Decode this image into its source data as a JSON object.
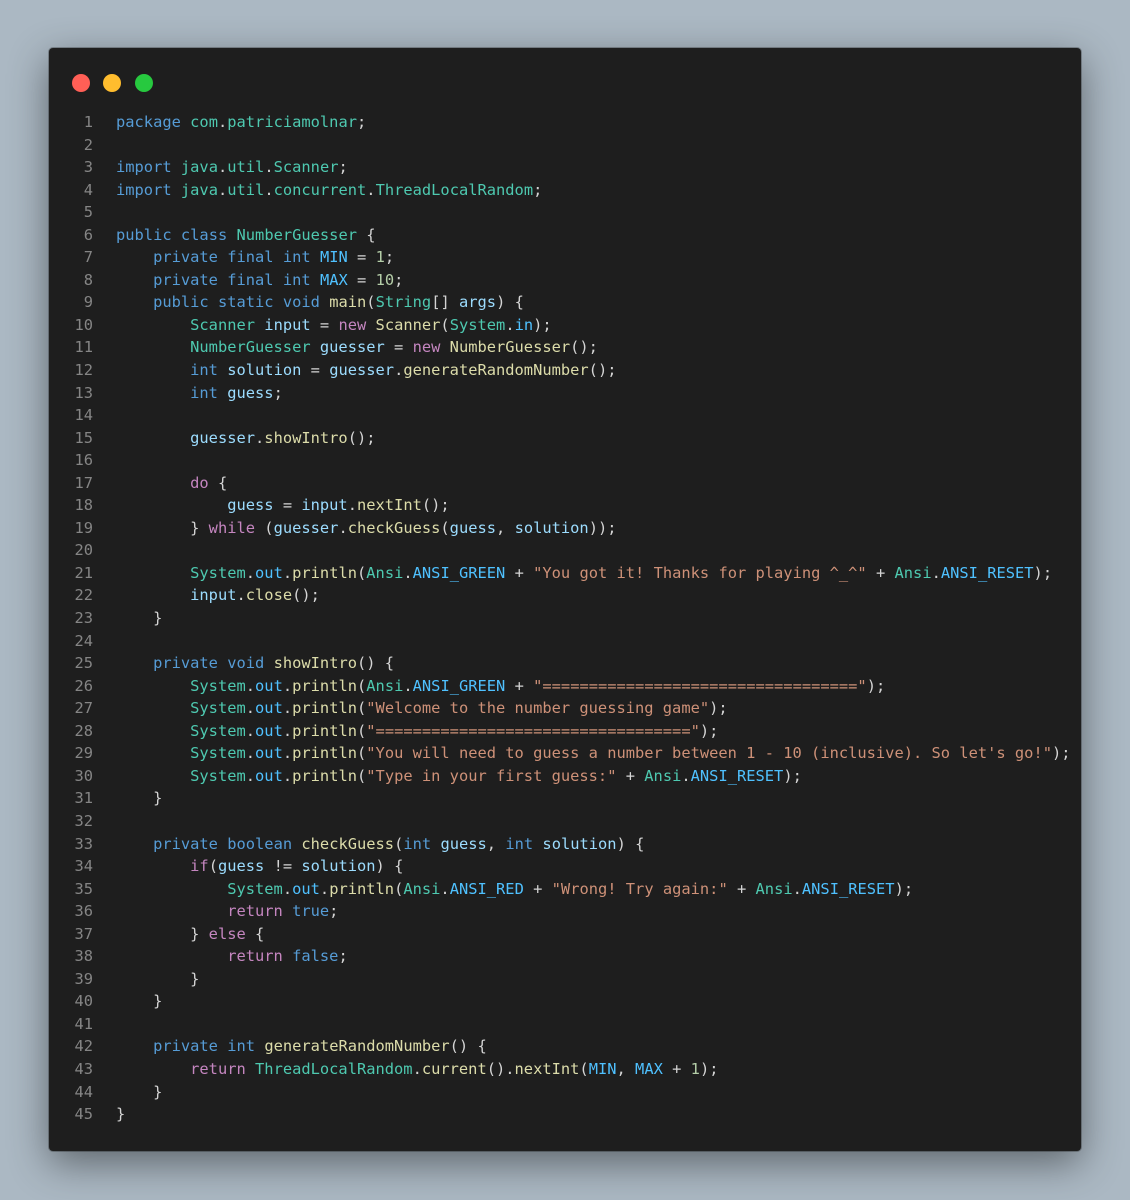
{
  "window": {
    "buttons": [
      "close",
      "minimize",
      "maximize"
    ],
    "colors": {
      "background": "#1e1e1e",
      "page_background": "#abb8c3",
      "close": "#ff5f56",
      "minimize": "#ffbd2e",
      "maximize": "#27c93f"
    }
  },
  "editor": {
    "language": "java",
    "lines": [
      [
        [
          "kw",
          "package"
        ],
        [
          "pl",
          " "
        ],
        [
          "ty",
          "com"
        ],
        [
          "pl",
          "."
        ],
        [
          "ty",
          "patriciamolnar"
        ],
        [
          "pl",
          ";"
        ]
      ],
      [],
      [
        [
          "kw",
          "import"
        ],
        [
          "pl",
          " "
        ],
        [
          "ty",
          "java"
        ],
        [
          "pl",
          "."
        ],
        [
          "ty",
          "util"
        ],
        [
          "pl",
          "."
        ],
        [
          "ty",
          "Scanner"
        ],
        [
          "pl",
          ";"
        ]
      ],
      [
        [
          "kw",
          "import"
        ],
        [
          "pl",
          " "
        ],
        [
          "ty",
          "java"
        ],
        [
          "pl",
          "."
        ],
        [
          "ty",
          "util"
        ],
        [
          "pl",
          "."
        ],
        [
          "ty",
          "concurrent"
        ],
        [
          "pl",
          "."
        ],
        [
          "ty",
          "ThreadLocalRandom"
        ],
        [
          "pl",
          ";"
        ]
      ],
      [],
      [
        [
          "kw",
          "public"
        ],
        [
          "pl",
          " "
        ],
        [
          "kw",
          "class"
        ],
        [
          "pl",
          " "
        ],
        [
          "ty",
          "NumberGuesser"
        ],
        [
          "pl",
          " {"
        ]
      ],
      [
        [
          "pl",
          "    "
        ],
        [
          "kw",
          "private"
        ],
        [
          "pl",
          " "
        ],
        [
          "kw",
          "final"
        ],
        [
          "pl",
          " "
        ],
        [
          "kw",
          "int"
        ],
        [
          "pl",
          " "
        ],
        [
          "cn",
          "MIN"
        ],
        [
          "pl",
          " = "
        ],
        [
          "nm",
          "1"
        ],
        [
          "pl",
          ";"
        ]
      ],
      [
        [
          "pl",
          "    "
        ],
        [
          "kw",
          "private"
        ],
        [
          "pl",
          " "
        ],
        [
          "kw",
          "final"
        ],
        [
          "pl",
          " "
        ],
        [
          "kw",
          "int"
        ],
        [
          "pl",
          " "
        ],
        [
          "cn",
          "MAX"
        ],
        [
          "pl",
          " = "
        ],
        [
          "nm",
          "10"
        ],
        [
          "pl",
          ";"
        ]
      ],
      [
        [
          "pl",
          "    "
        ],
        [
          "kw",
          "public"
        ],
        [
          "pl",
          " "
        ],
        [
          "kw",
          "static"
        ],
        [
          "pl",
          " "
        ],
        [
          "kw",
          "void"
        ],
        [
          "pl",
          " "
        ],
        [
          "fn",
          "main"
        ],
        [
          "pl",
          "("
        ],
        [
          "ty",
          "String"
        ],
        [
          "pl",
          "[] "
        ],
        [
          "vr",
          "args"
        ],
        [
          "pl",
          ") {"
        ]
      ],
      [
        [
          "pl",
          "        "
        ],
        [
          "ty",
          "Scanner"
        ],
        [
          "pl",
          " "
        ],
        [
          "vr",
          "input"
        ],
        [
          "pl",
          " = "
        ],
        [
          "ctl",
          "new"
        ],
        [
          "pl",
          " "
        ],
        [
          "fn",
          "Scanner"
        ],
        [
          "pl",
          "("
        ],
        [
          "ty",
          "System"
        ],
        [
          "pl",
          "."
        ],
        [
          "cn",
          "in"
        ],
        [
          "pl",
          ");"
        ]
      ],
      [
        [
          "pl",
          "        "
        ],
        [
          "ty",
          "NumberGuesser"
        ],
        [
          "pl",
          " "
        ],
        [
          "vr",
          "guesser"
        ],
        [
          "pl",
          " = "
        ],
        [
          "ctl",
          "new"
        ],
        [
          "pl",
          " "
        ],
        [
          "fn",
          "NumberGuesser"
        ],
        [
          "pl",
          "();"
        ]
      ],
      [
        [
          "pl",
          "        "
        ],
        [
          "kw",
          "int"
        ],
        [
          "pl",
          " "
        ],
        [
          "vr",
          "solution"
        ],
        [
          "pl",
          " = "
        ],
        [
          "vr",
          "guesser"
        ],
        [
          "pl",
          "."
        ],
        [
          "fn",
          "generateRandomNumber"
        ],
        [
          "pl",
          "();"
        ]
      ],
      [
        [
          "pl",
          "        "
        ],
        [
          "kw",
          "int"
        ],
        [
          "pl",
          " "
        ],
        [
          "vr",
          "guess"
        ],
        [
          "pl",
          ";"
        ]
      ],
      [],
      [
        [
          "pl",
          "        "
        ],
        [
          "vr",
          "guesser"
        ],
        [
          "pl",
          "."
        ],
        [
          "fn",
          "showIntro"
        ],
        [
          "pl",
          "();"
        ]
      ],
      [],
      [
        [
          "pl",
          "        "
        ],
        [
          "ctl",
          "do"
        ],
        [
          "pl",
          " {"
        ]
      ],
      [
        [
          "pl",
          "            "
        ],
        [
          "vr",
          "guess"
        ],
        [
          "pl",
          " = "
        ],
        [
          "vr",
          "input"
        ],
        [
          "pl",
          "."
        ],
        [
          "fn",
          "nextInt"
        ],
        [
          "pl",
          "();"
        ]
      ],
      [
        [
          "pl",
          "        } "
        ],
        [
          "ctl",
          "while"
        ],
        [
          "pl",
          " ("
        ],
        [
          "vr",
          "guesser"
        ],
        [
          "pl",
          "."
        ],
        [
          "fn",
          "checkGuess"
        ],
        [
          "pl",
          "("
        ],
        [
          "vr",
          "guess"
        ],
        [
          "pl",
          ", "
        ],
        [
          "vr",
          "solution"
        ],
        [
          "pl",
          "));"
        ]
      ],
      [],
      [
        [
          "pl",
          "        "
        ],
        [
          "ty",
          "System"
        ],
        [
          "pl",
          "."
        ],
        [
          "cn",
          "out"
        ],
        [
          "pl",
          "."
        ],
        [
          "fn",
          "println"
        ],
        [
          "pl",
          "("
        ],
        [
          "ty",
          "Ansi"
        ],
        [
          "pl",
          "."
        ],
        [
          "cn",
          "ANSI_GREEN"
        ],
        [
          "pl",
          " + "
        ],
        [
          "st",
          "\"You got it! Thanks for playing ^_^\""
        ],
        [
          "pl",
          " + "
        ],
        [
          "ty",
          "Ansi"
        ],
        [
          "pl",
          "."
        ],
        [
          "cn",
          "ANSI_RESET"
        ],
        [
          "pl",
          ");"
        ]
      ],
      [
        [
          "pl",
          "        "
        ],
        [
          "vr",
          "input"
        ],
        [
          "pl",
          "."
        ],
        [
          "fn",
          "close"
        ],
        [
          "pl",
          "();"
        ]
      ],
      [
        [
          "pl",
          "    }"
        ]
      ],
      [],
      [
        [
          "pl",
          "    "
        ],
        [
          "kw",
          "private"
        ],
        [
          "pl",
          " "
        ],
        [
          "kw",
          "void"
        ],
        [
          "pl",
          " "
        ],
        [
          "fn",
          "showIntro"
        ],
        [
          "pl",
          "() {"
        ]
      ],
      [
        [
          "pl",
          "        "
        ],
        [
          "ty",
          "System"
        ],
        [
          "pl",
          "."
        ],
        [
          "cn",
          "out"
        ],
        [
          "pl",
          "."
        ],
        [
          "fn",
          "println"
        ],
        [
          "pl",
          "("
        ],
        [
          "ty",
          "Ansi"
        ],
        [
          "pl",
          "."
        ],
        [
          "cn",
          "ANSI_GREEN"
        ],
        [
          "pl",
          " + "
        ],
        [
          "st",
          "\"==================================\""
        ],
        [
          "pl",
          ");"
        ]
      ],
      [
        [
          "pl",
          "        "
        ],
        [
          "ty",
          "System"
        ],
        [
          "pl",
          "."
        ],
        [
          "cn",
          "out"
        ],
        [
          "pl",
          "."
        ],
        [
          "fn",
          "println"
        ],
        [
          "pl",
          "("
        ],
        [
          "st",
          "\"Welcome to the number guessing game\""
        ],
        [
          "pl",
          ");"
        ]
      ],
      [
        [
          "pl",
          "        "
        ],
        [
          "ty",
          "System"
        ],
        [
          "pl",
          "."
        ],
        [
          "cn",
          "out"
        ],
        [
          "pl",
          "."
        ],
        [
          "fn",
          "println"
        ],
        [
          "pl",
          "("
        ],
        [
          "st",
          "\"==================================\""
        ],
        [
          "pl",
          ");"
        ]
      ],
      [
        [
          "pl",
          "        "
        ],
        [
          "ty",
          "System"
        ],
        [
          "pl",
          "."
        ],
        [
          "cn",
          "out"
        ],
        [
          "pl",
          "."
        ],
        [
          "fn",
          "println"
        ],
        [
          "pl",
          "("
        ],
        [
          "st",
          "\"You will need to guess a number between 1 - 10 (inclusive). So let's go!\""
        ],
        [
          "pl",
          ");"
        ]
      ],
      [
        [
          "pl",
          "        "
        ],
        [
          "ty",
          "System"
        ],
        [
          "pl",
          "."
        ],
        [
          "cn",
          "out"
        ],
        [
          "pl",
          "."
        ],
        [
          "fn",
          "println"
        ],
        [
          "pl",
          "("
        ],
        [
          "st",
          "\"Type in your first guess:\""
        ],
        [
          "pl",
          " + "
        ],
        [
          "ty",
          "Ansi"
        ],
        [
          "pl",
          "."
        ],
        [
          "cn",
          "ANSI_RESET"
        ],
        [
          "pl",
          ");"
        ]
      ],
      [
        [
          "pl",
          "    }"
        ]
      ],
      [],
      [
        [
          "pl",
          "    "
        ],
        [
          "kw",
          "private"
        ],
        [
          "pl",
          " "
        ],
        [
          "kw",
          "boolean"
        ],
        [
          "pl",
          " "
        ],
        [
          "fn",
          "checkGuess"
        ],
        [
          "pl",
          "("
        ],
        [
          "kw",
          "int"
        ],
        [
          "pl",
          " "
        ],
        [
          "vr",
          "guess"
        ],
        [
          "pl",
          ", "
        ],
        [
          "kw",
          "int"
        ],
        [
          "pl",
          " "
        ],
        [
          "vr",
          "solution"
        ],
        [
          "pl",
          ") {"
        ]
      ],
      [
        [
          "pl",
          "        "
        ],
        [
          "ctl",
          "if"
        ],
        [
          "pl",
          "("
        ],
        [
          "vr",
          "guess"
        ],
        [
          "pl",
          " != "
        ],
        [
          "vr",
          "solution"
        ],
        [
          "pl",
          ") {"
        ]
      ],
      [
        [
          "pl",
          "            "
        ],
        [
          "ty",
          "System"
        ],
        [
          "pl",
          "."
        ],
        [
          "cn",
          "out"
        ],
        [
          "pl",
          "."
        ],
        [
          "fn",
          "println"
        ],
        [
          "pl",
          "("
        ],
        [
          "ty",
          "Ansi"
        ],
        [
          "pl",
          "."
        ],
        [
          "cn",
          "ANSI_RED"
        ],
        [
          "pl",
          " + "
        ],
        [
          "st",
          "\"Wrong! Try again:\""
        ],
        [
          "pl",
          " + "
        ],
        [
          "ty",
          "Ansi"
        ],
        [
          "pl",
          "."
        ],
        [
          "cn",
          "ANSI_RESET"
        ],
        [
          "pl",
          ");"
        ]
      ],
      [
        [
          "pl",
          "            "
        ],
        [
          "ctl",
          "return"
        ],
        [
          "pl",
          " "
        ],
        [
          "kw",
          "true"
        ],
        [
          "pl",
          ";"
        ]
      ],
      [
        [
          "pl",
          "        } "
        ],
        [
          "ctl",
          "else"
        ],
        [
          "pl",
          " {"
        ]
      ],
      [
        [
          "pl",
          "            "
        ],
        [
          "ctl",
          "return"
        ],
        [
          "pl",
          " "
        ],
        [
          "kw",
          "false"
        ],
        [
          "pl",
          ";"
        ]
      ],
      [
        [
          "pl",
          "        }"
        ]
      ],
      [
        [
          "pl",
          "    }"
        ]
      ],
      [],
      [
        [
          "pl",
          "    "
        ],
        [
          "kw",
          "private"
        ],
        [
          "pl",
          " "
        ],
        [
          "kw",
          "int"
        ],
        [
          "pl",
          " "
        ],
        [
          "fn",
          "generateRandomNumber"
        ],
        [
          "pl",
          "() {"
        ]
      ],
      [
        [
          "pl",
          "        "
        ],
        [
          "ctl",
          "return"
        ],
        [
          "pl",
          " "
        ],
        [
          "ty",
          "ThreadLocalRandom"
        ],
        [
          "pl",
          "."
        ],
        [
          "fn",
          "current"
        ],
        [
          "pl",
          "()."
        ],
        [
          "fn",
          "nextInt"
        ],
        [
          "pl",
          "("
        ],
        [
          "cn",
          "MIN"
        ],
        [
          "pl",
          ", "
        ],
        [
          "cn",
          "MAX"
        ],
        [
          "pl",
          " + "
        ],
        [
          "nm",
          "1"
        ],
        [
          "pl",
          ");"
        ]
      ],
      [
        [
          "pl",
          "    }"
        ]
      ],
      [
        [
          "pl",
          "}"
        ]
      ]
    ]
  }
}
